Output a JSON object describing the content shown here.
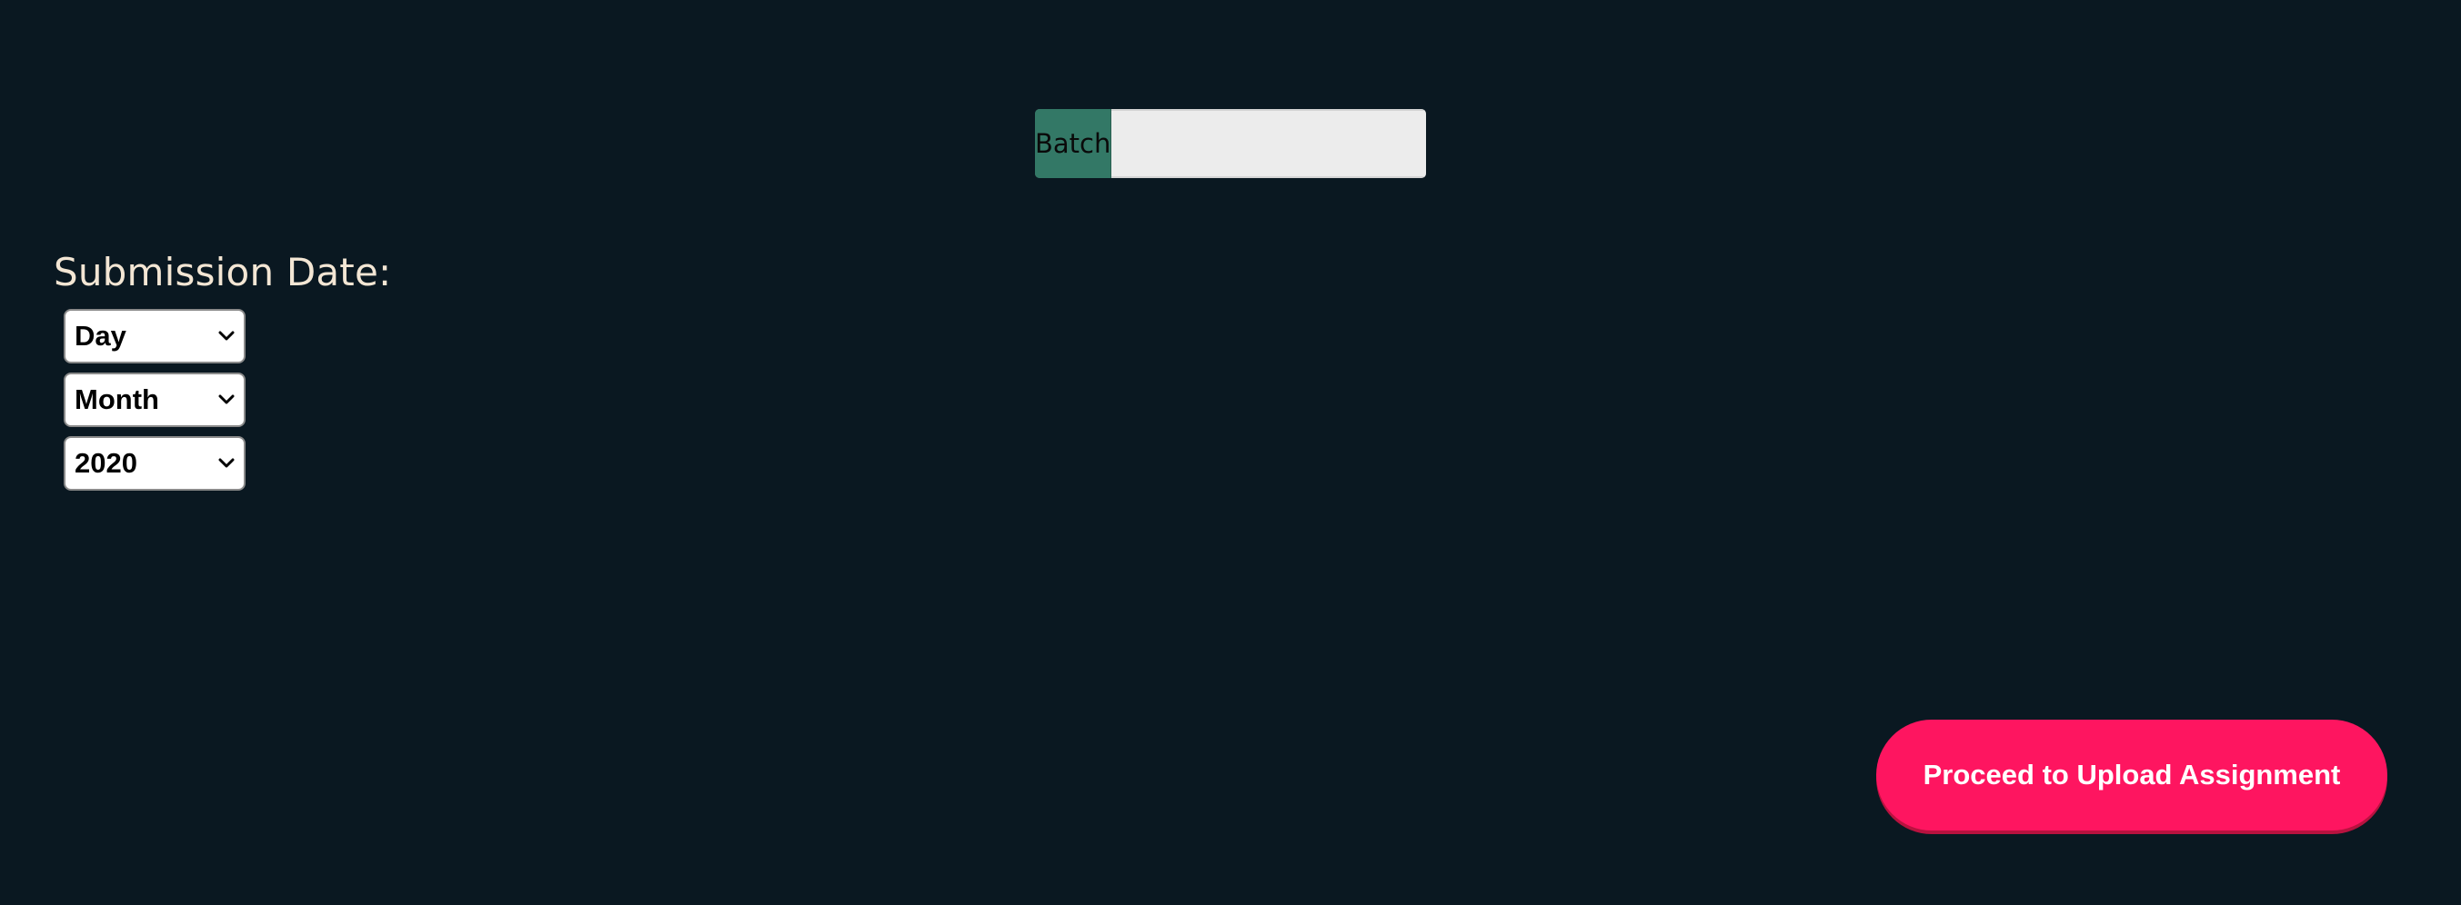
{
  "batch": {
    "label": "Batch",
    "value": ""
  },
  "submission": {
    "title": "Submission Date:",
    "day": {
      "selected": "Day"
    },
    "month": {
      "selected": "Month"
    },
    "year": {
      "selected": "2020"
    }
  },
  "actions": {
    "proceed_label": "Proceed to Upload Assignment"
  },
  "colors": {
    "background": "#0a1821",
    "batch_label_bg": "#337866",
    "title_text": "#f3e6d4",
    "proceed_bg": "#fe1560"
  },
  "icons": {
    "select_arrow": "chevron-down-icon"
  }
}
